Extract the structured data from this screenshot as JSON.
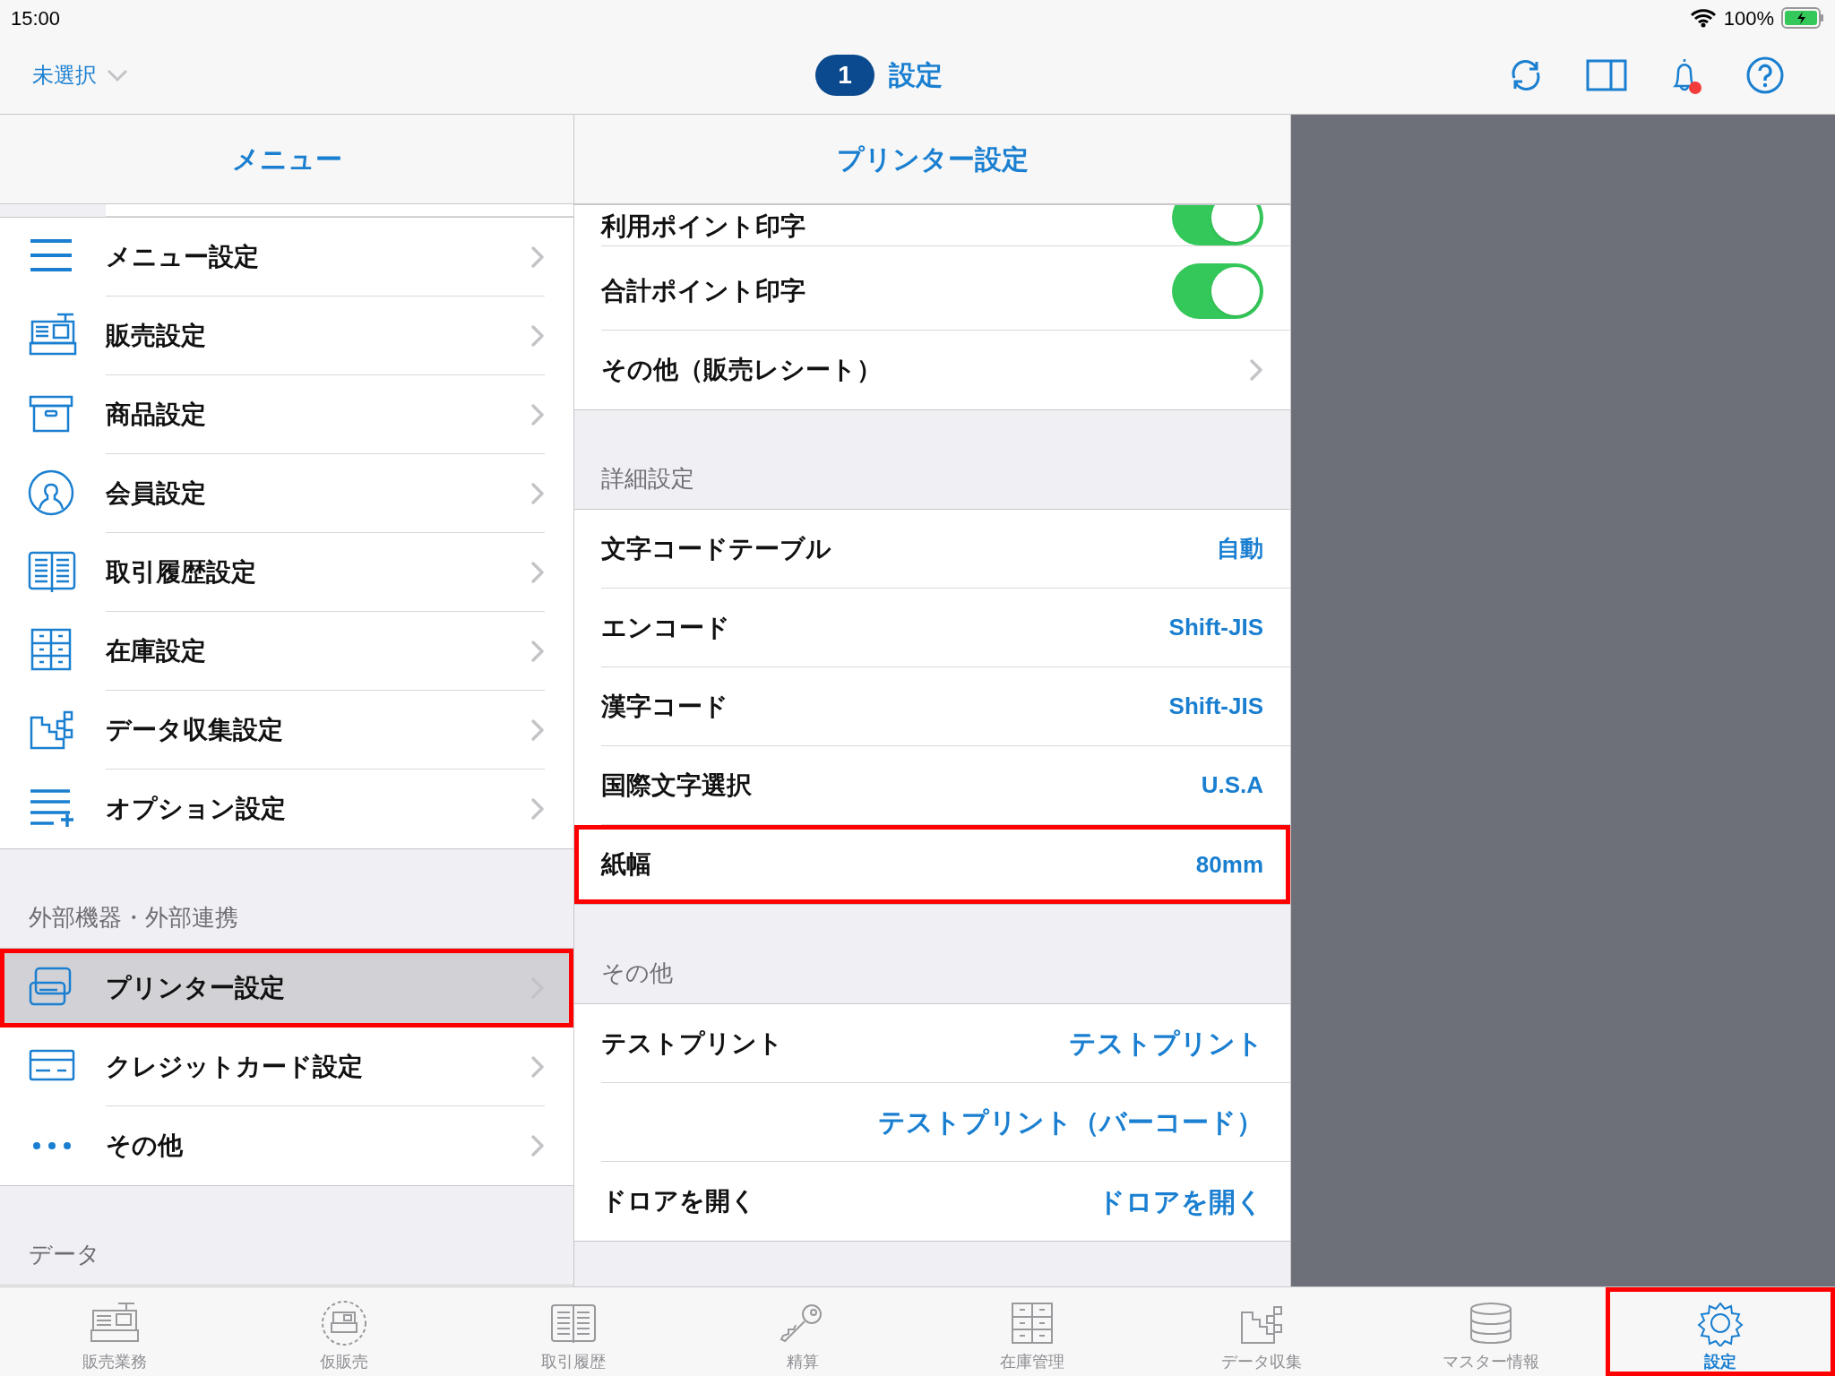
{
  "status_bar": {
    "time": "15:00",
    "battery": "100%"
  },
  "nav": {
    "selector": "未選択",
    "badge": "1",
    "title": "設定"
  },
  "menu": {
    "title": "メニュー",
    "sections": [
      {
        "items": [
          {
            "label": "メニュー設定",
            "selected": false,
            "highlighted": false
          },
          {
            "label": "販売設定",
            "selected": false,
            "highlighted": false
          },
          {
            "label": "商品設定",
            "selected": false,
            "highlighted": false
          },
          {
            "label": "会員設定",
            "selected": false,
            "highlighted": false
          },
          {
            "label": "取引履歴設定",
            "selected": false,
            "highlighted": false
          },
          {
            "label": "在庫設定",
            "selected": false,
            "highlighted": false
          },
          {
            "label": "データ収集設定",
            "selected": false,
            "highlighted": false
          },
          {
            "label": "オプション設定",
            "selected": false,
            "highlighted": false
          }
        ]
      },
      {
        "header": "外部機器・外部連携",
        "items": [
          {
            "label": "プリンター設定",
            "selected": true,
            "highlighted": true
          },
          {
            "label": "クレジットカード設定",
            "selected": false,
            "highlighted": false
          },
          {
            "label": "その他",
            "selected": false,
            "highlighted": false
          }
        ]
      },
      {
        "header": "データ"
      }
    ]
  },
  "printer": {
    "title": "プリンター設定",
    "sections": [
      {
        "rows": [
          {
            "kind": "toggle",
            "label": "利用ポイント印字",
            "on": true,
            "partial": true
          },
          {
            "kind": "toggle",
            "label": "合計ポイント印字",
            "on": true
          },
          {
            "kind": "disclosure",
            "label": "その他（販売レシート）"
          }
        ]
      },
      {
        "header": "詳細設定",
        "rows": [
          {
            "kind": "value",
            "label": "文字コードテーブル",
            "value": "自動"
          },
          {
            "kind": "value",
            "label": "エンコード",
            "value": "Shift-JIS"
          },
          {
            "kind": "value",
            "label": "漢字コード",
            "value": "Shift-JIS"
          },
          {
            "kind": "value",
            "label": "国際文字選択",
            "value": "U.S.A"
          },
          {
            "kind": "value",
            "label": "紙幅",
            "value": "80mm",
            "highlighted": true
          }
        ]
      },
      {
        "header": "その他",
        "rows": [
          {
            "kind": "action",
            "label": "テストプリント",
            "action": "テストプリント"
          },
          {
            "kind": "action",
            "action": "テストプリント（バーコード）"
          },
          {
            "kind": "action",
            "label": "ドロアを開く",
            "action": "ドロアを開く"
          }
        ]
      }
    ]
  },
  "tab_bar": [
    {
      "label": "販売業務",
      "selected": false,
      "highlighted": false
    },
    {
      "label": "仮販売",
      "selected": false,
      "highlighted": false
    },
    {
      "label": "取引履歴",
      "selected": false,
      "highlighted": false
    },
    {
      "label": "精算",
      "selected": false,
      "highlighted": false
    },
    {
      "label": "在庫管理",
      "selected": false,
      "highlighted": false
    },
    {
      "label": "データ収集",
      "selected": false,
      "highlighted": false
    },
    {
      "label": "マスター情報",
      "selected": false,
      "highlighted": false
    },
    {
      "label": "設定",
      "selected": true,
      "highlighted": true
    }
  ]
}
